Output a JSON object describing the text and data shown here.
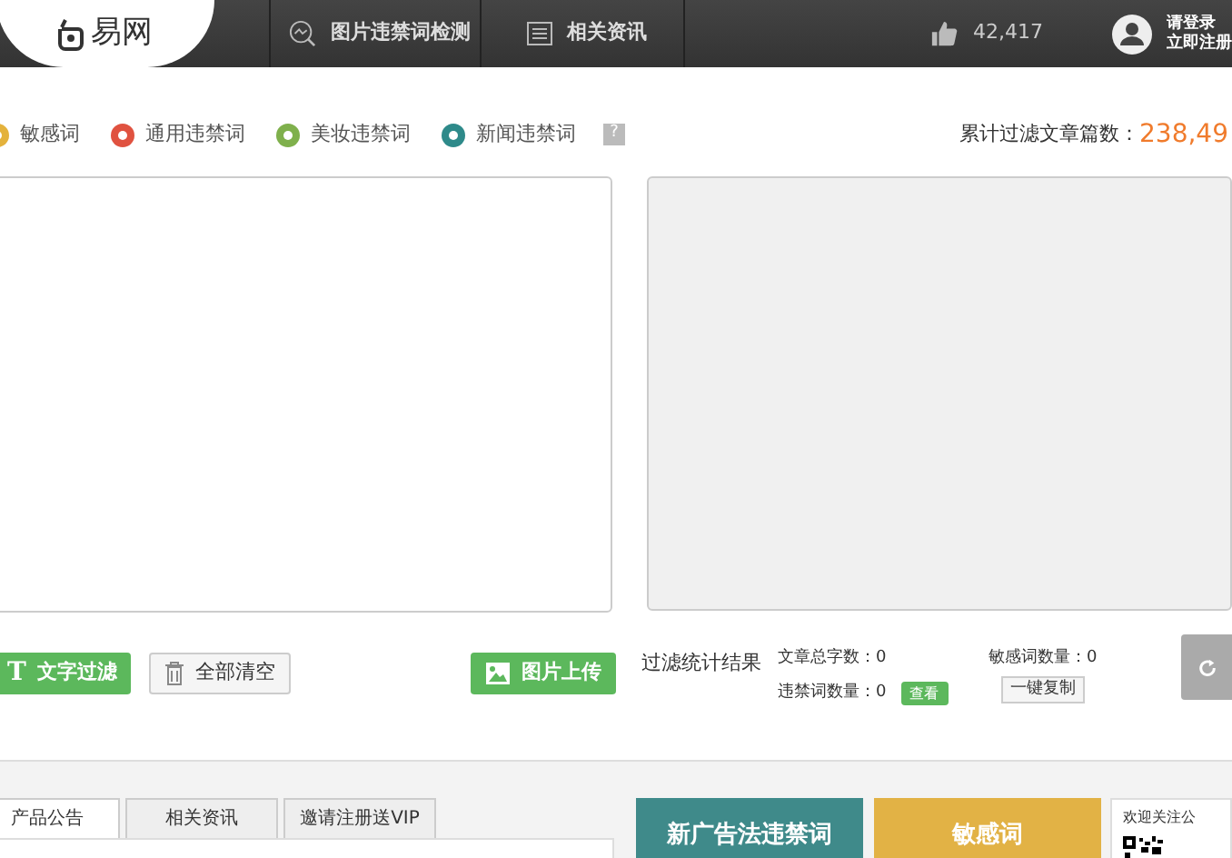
{
  "header": {
    "logo": "易网",
    "nav": [
      {
        "label": "图片违禁词检测",
        "kind": "search"
      },
      {
        "label": "相关资讯",
        "kind": "doc"
      }
    ],
    "likes": "42,417",
    "login": "请登录",
    "register": "立即注册"
  },
  "legend": [
    {
      "label": "敏感词",
      "color": "#e4b23c"
    },
    {
      "label": "通用违禁词",
      "color": "#e05240"
    },
    {
      "label": "美妆违禁词",
      "color": "#7fb04c"
    },
    {
      "label": "新闻违禁词",
      "color": "#2e8a8a"
    }
  ],
  "help": "?",
  "total": {
    "label": "累计过滤文章篇数：",
    "value": "238,49"
  },
  "buttons": {
    "filter_icon": "T",
    "filter": "文字过滤",
    "clear": "全部清空",
    "upload": "图片上传"
  },
  "stats": {
    "title": "过滤统计结果",
    "word_count": "文章总字数：0",
    "banned_count": "违禁词数量：0",
    "view": "查看",
    "sensitive_count": "敏感词数量：0",
    "copy": "一键复制"
  },
  "tabs": [
    {
      "label": "产品公告",
      "selected": true
    },
    {
      "label": "相关资讯",
      "selected": false
    },
    {
      "label": "邀请注册送VIP",
      "selected": false
    }
  ],
  "tiles": [
    {
      "label": "新广告法违禁词",
      "color": "#3f8a8a"
    },
    {
      "label": "敏感词",
      "color": "#e2b245"
    }
  ],
  "follow": "欢迎关注公"
}
